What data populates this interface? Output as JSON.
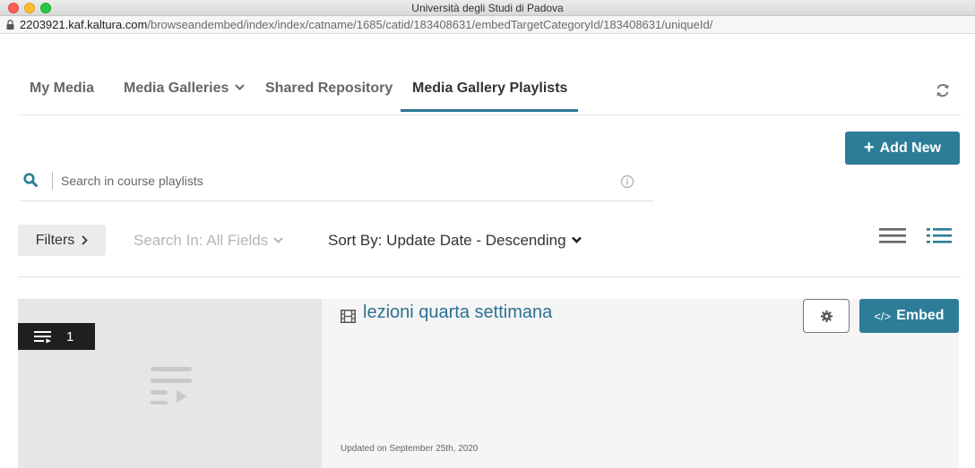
{
  "window": {
    "title": "Università degli Studi di Padova",
    "url_host": "2203921.kaf.kaltura.com",
    "url_path": "/browseandembed/index/index/catname/1685/catid/183408631/embedTargetCategoryId/183408631/uniqueId/"
  },
  "tabs": [
    {
      "label": "My Media"
    },
    {
      "label": "Media Galleries"
    },
    {
      "label": "Shared Repository"
    },
    {
      "label": "Media Gallery Playlists",
      "active": true
    }
  ],
  "toolbar": {
    "add_new_label": "Add New"
  },
  "search": {
    "placeholder": "Search in course playlists"
  },
  "filters": {
    "button_label": "Filters",
    "search_in_label": "Search In: All Fields",
    "sort_label": "Sort By: Update Date - Descending"
  },
  "entry": {
    "count": "1",
    "title": "lezioni quarta settimana",
    "updated": "Updated on September 25th, 2020",
    "embed_label": "Embed",
    "embed_code_glyph": "</>"
  },
  "colors": {
    "accent": "#2d7d99",
    "title_link": "#2b7191"
  },
  "icons": [
    "lock-icon",
    "refresh-icon",
    "search-icon",
    "info-icon",
    "list-view-icon",
    "detail-view-icon",
    "playlist-icon",
    "film-icon",
    "gear-icon"
  ]
}
